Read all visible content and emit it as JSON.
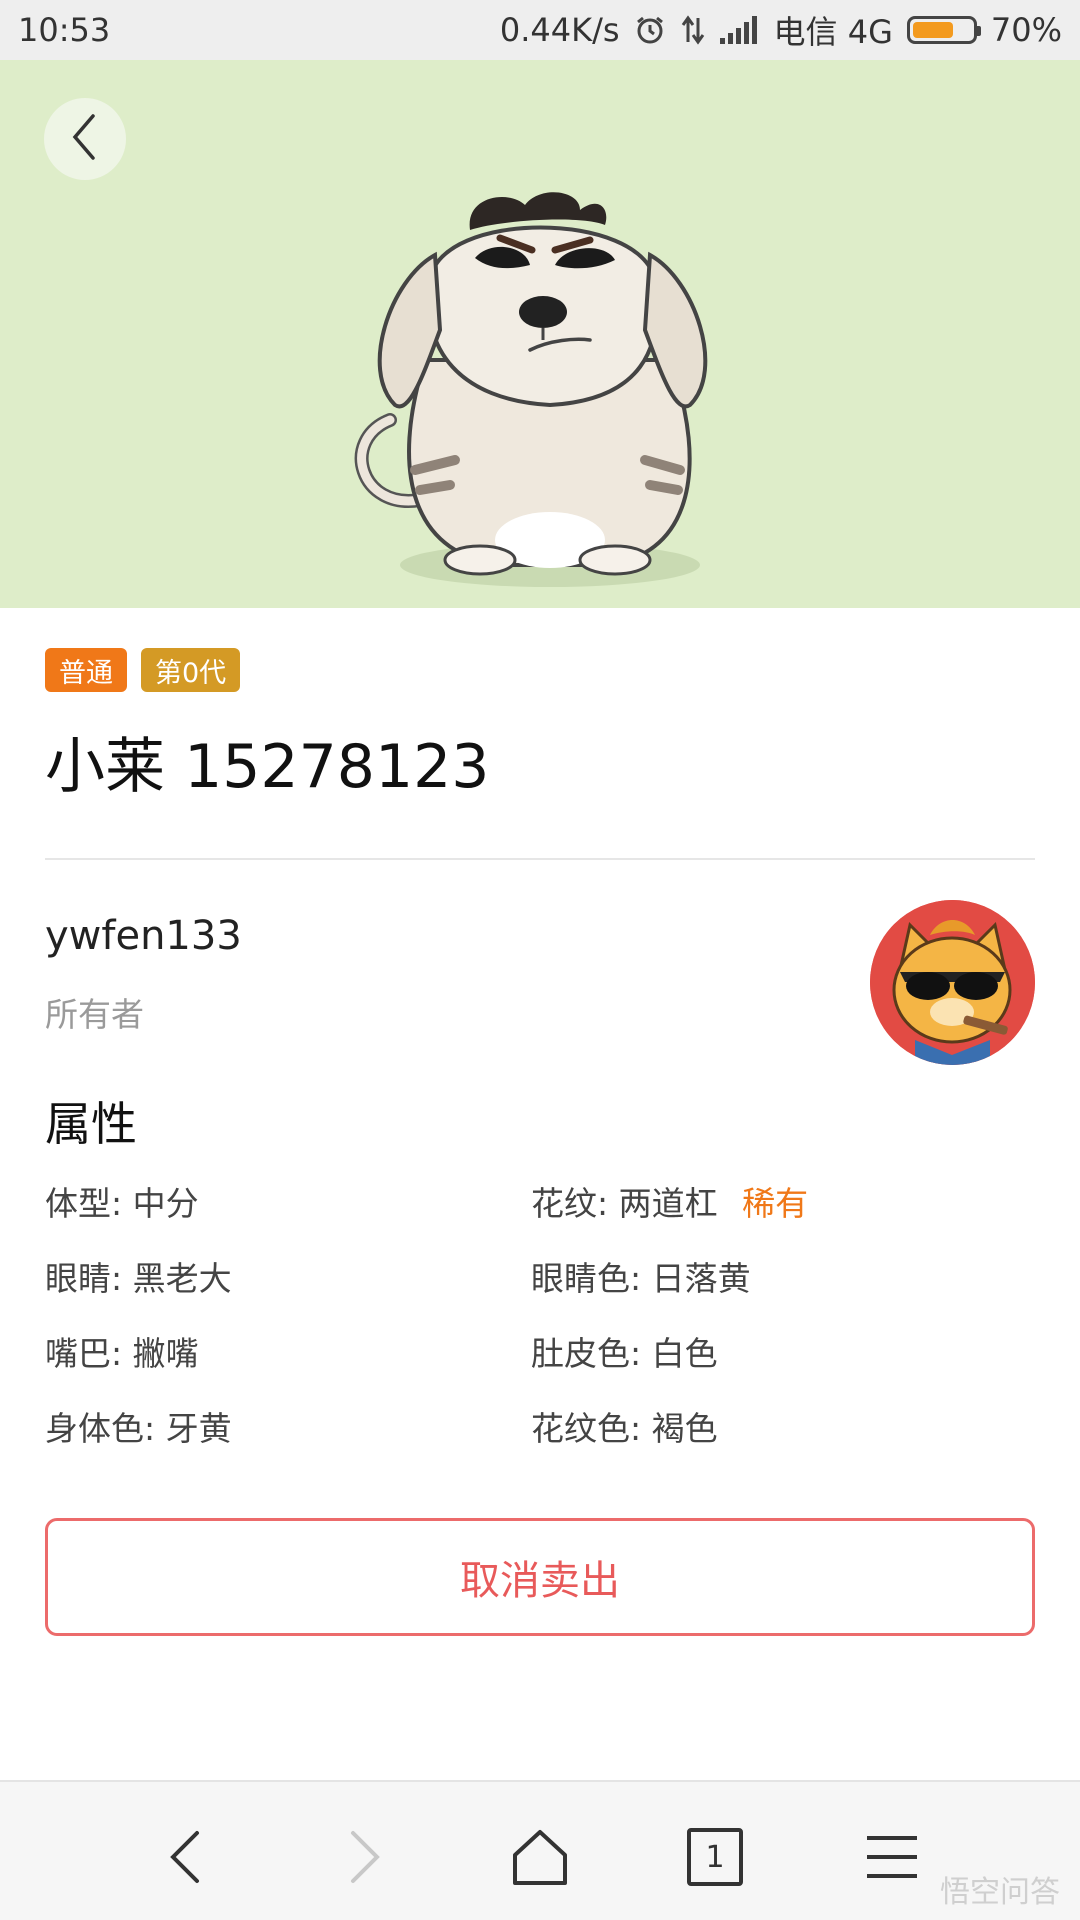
{
  "status_bar": {
    "time": "10:53",
    "speed": "0.44K/s",
    "carrier": "电信 4G",
    "battery_percent_text": "70%",
    "battery_level": 0.7,
    "icons": [
      "alarm-icon",
      "data-transfer-icon",
      "signal-icon",
      "battery-icon"
    ]
  },
  "hero": {
    "back_icon": "chevron-left-icon",
    "background_color": "#deedc9"
  },
  "pet": {
    "tags": [
      {
        "label": "普通",
        "color": "#f07818"
      },
      {
        "label": "第0代",
        "color": "#d49a25"
      }
    ],
    "title": "小莱 15278123"
  },
  "owner": {
    "name": "ywfen133",
    "label": "所有者"
  },
  "attributes": {
    "heading": "属性",
    "rows": [
      [
        {
          "label": "体型:",
          "value": "中分",
          "rare": ""
        },
        {
          "label": "花纹:",
          "value": "两道杠",
          "rare": "稀有"
        }
      ],
      [
        {
          "label": "眼睛:",
          "value": "黑老大",
          "rare": ""
        },
        {
          "label": "眼睛色:",
          "value": "日落黄",
          "rare": ""
        }
      ],
      [
        {
          "label": "嘴巴:",
          "value": "撇嘴",
          "rare": ""
        },
        {
          "label": "肚皮色:",
          "value": "白色",
          "rare": ""
        }
      ],
      [
        {
          "label": "身体色:",
          "value": "牙黄",
          "rare": ""
        },
        {
          "label": "花纹色:",
          "value": "褐色",
          "rare": ""
        }
      ]
    ]
  },
  "actions": {
    "cancel_sale": "取消卖出",
    "accent_color": "#e85a5a"
  },
  "bottom_nav": {
    "tab_count": "1",
    "icons": [
      "back-arrow-icon",
      "forward-arrow-icon",
      "home-icon",
      "tabs-icon",
      "menu-icon"
    ],
    "watermark": "悟空问答"
  }
}
